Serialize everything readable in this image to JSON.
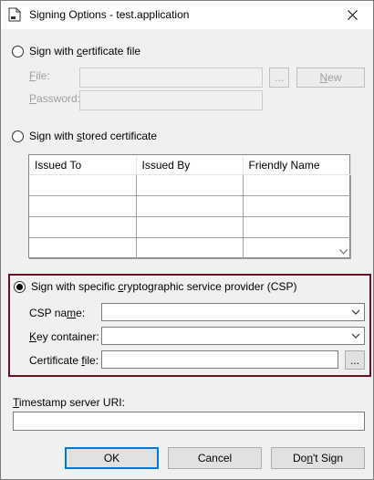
{
  "window": {
    "title": "Signing Options - test.application"
  },
  "cert_file": {
    "radio_label_pre": "Sign with ",
    "radio_label_u": "c",
    "radio_label_post": "ertificate file",
    "file_label_u": "F",
    "file_label_post": "ile:",
    "password_label_u": "P",
    "password_label_post": "assword:",
    "browse_label": "...",
    "new_label_u": "N",
    "new_label_post": "ew"
  },
  "stored_cert": {
    "radio_label_pre": "Sign with ",
    "radio_label_u": "s",
    "radio_label_post": "tored certificate",
    "columns": [
      "Issued To",
      "Issued By",
      "Friendly Name"
    ]
  },
  "csp": {
    "radio_label_pre": "Sign with specific ",
    "radio_label_u": "c",
    "radio_label_post": "ryptographic service provider (CSP)",
    "csp_name_pre": "CSP na",
    "csp_name_u": "m",
    "csp_name_post": "e:",
    "key_container_u": "K",
    "key_container_post": "ey container:",
    "cert_file_pre": "Certificate ",
    "cert_file_u": "f",
    "cert_file_post": "ile:",
    "browse_label": "...",
    "accent": "#6b1126"
  },
  "timestamp": {
    "label_u": "T",
    "label_post": "imestamp server URI:",
    "value": ""
  },
  "buttons": {
    "ok": "OK",
    "cancel": "Cancel",
    "dont_sign_pre": "Do",
    "dont_sign_u": "n",
    "dont_sign_post": "'t Sign"
  },
  "colors": {
    "focus": "#0078d7",
    "border": "#7a7a7a"
  }
}
